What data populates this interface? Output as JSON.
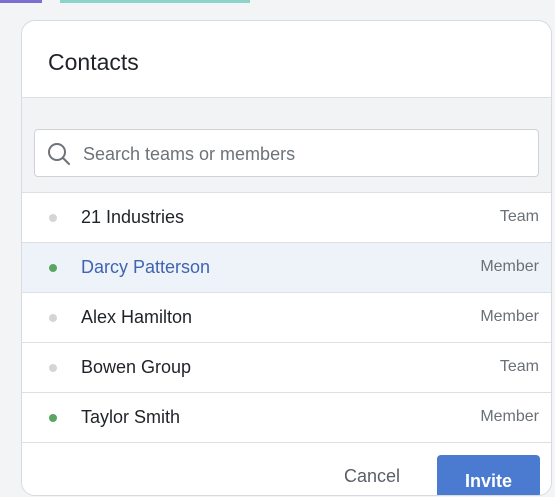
{
  "dialog": {
    "title": "Contacts",
    "search": {
      "placeholder": "Search teams or members",
      "value": ""
    },
    "contacts": [
      {
        "name": "21 Industries",
        "type": "Team",
        "status": "offline",
        "selected": false
      },
      {
        "name": "Darcy Patterson",
        "type": "Member",
        "status": "online",
        "selected": true
      },
      {
        "name": "Alex Hamilton",
        "type": "Member",
        "status": "offline",
        "selected": false
      },
      {
        "name": "Bowen Group",
        "type": "Team",
        "status": "offline",
        "selected": false
      },
      {
        "name": "Taylor Smith",
        "type": "Member",
        "status": "online",
        "selected": false
      }
    ],
    "footer": {
      "cancel_label": "Cancel",
      "invite_label": "Invite"
    }
  },
  "colors": {
    "accent": "#4a7bd0",
    "selected_text": "#3f64b0",
    "selected_bg": "#eef3fa",
    "status_online": "#5aa661",
    "status_offline": "#d3d5d8",
    "top_strip": [
      "#7b6fd1",
      "#8ed3c9",
      "#cfd5dc"
    ]
  },
  "icons": {
    "search": "search-icon",
    "status": "status-dot"
  }
}
